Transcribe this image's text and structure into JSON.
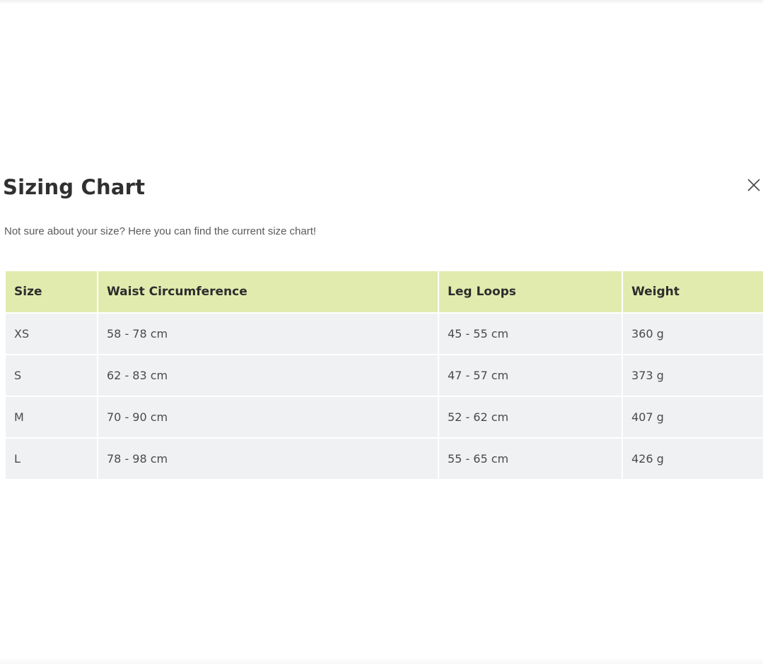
{
  "modal": {
    "title": "Sizing Chart",
    "subtitle": "Not sure about your size? Here you can find the current size chart!",
    "close_icon": "close-icon"
  },
  "table": {
    "header_color": "#e1ebae",
    "row_color": "#f0f1f3",
    "columns": [
      "Size",
      "Waist Circumference",
      "Leg Loops",
      "Weight"
    ],
    "rows": [
      [
        "XS",
        "58 - 78 cm",
        "45 - 55 cm",
        "360 g"
      ],
      [
        "S",
        "62 - 83 cm",
        "47 - 57 cm",
        "373 g"
      ],
      [
        "M",
        "70 - 90 cm",
        "52 - 62 cm",
        "407 g"
      ],
      [
        "L",
        "78 - 98 cm",
        "55 - 65 cm",
        "426 g"
      ]
    ]
  }
}
